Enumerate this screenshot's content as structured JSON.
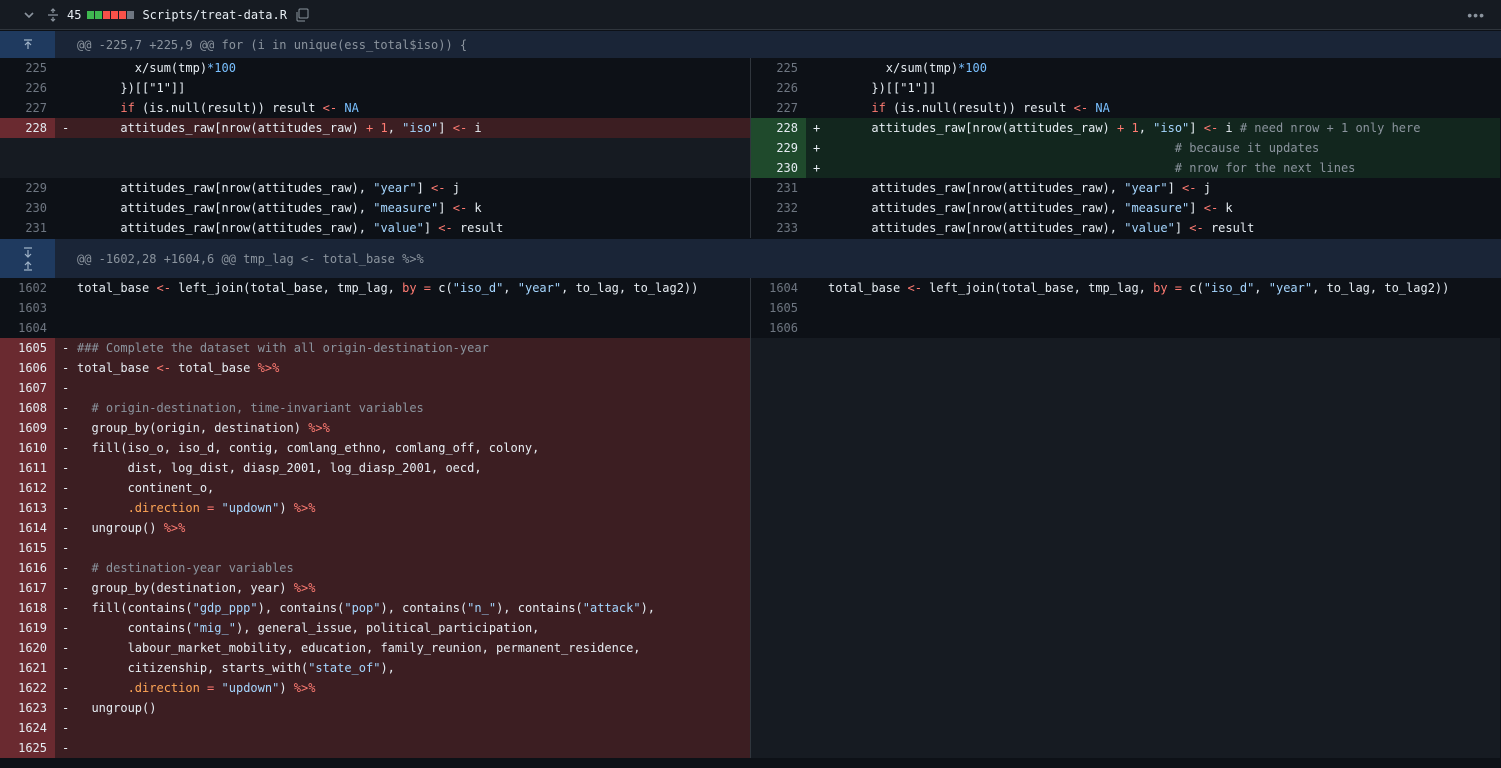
{
  "file_header": {
    "line_count": "45",
    "diffstat_colors": [
      "#3fb950",
      "#3fb950",
      "#f85149",
      "#f85149",
      "#f85149",
      "#6e7681"
    ],
    "file_name": "Scripts/treat-data.R"
  },
  "hunks": [
    {
      "text": "@@ -225,7 +225,9 @@ for (i in unique(ess_total$iso)) {"
    },
    {
      "text": "@@ -1602,28 +1604,6 @@ tmp_lag <- total_base %>%"
    }
  ],
  "line_numbers": {
    "h1_left": [
      "225",
      "226",
      "227",
      "228",
      "229",
      "230",
      "231"
    ],
    "h1_right": [
      "225",
      "226",
      "227",
      "228",
      "229",
      "230",
      "231",
      "232",
      "233"
    ],
    "h2_left": [
      "1602",
      "1603",
      "1604",
      "1605",
      "1606",
      "1607",
      "1608",
      "1609",
      "1610",
      "1611",
      "1612",
      "1613",
      "1614",
      "1615",
      "1616",
      "1617",
      "1618",
      "1619",
      "1620",
      "1621",
      "1622",
      "1623",
      "1624",
      "1625"
    ],
    "h2_right": [
      "1604",
      "1605",
      "1606"
    ]
  },
  "markers": {
    "minus": "-",
    "plus": "+"
  },
  "code": {
    "c_x": "x/sum(tmp)",
    "c_100": "*100",
    "c_close": "})[[\"1\"]]",
    "c_if": "if",
    "c_isnull": " (is.null(result)) result ",
    "c_larrow": "<-",
    "c_na": "NA",
    "c_attr_a": "attitudes_raw[nrow(attitudes_raw) ",
    "c_plus1": "+ 1",
    "c_comma": ", ",
    "c_iso": "\"iso\"",
    "c_bracket_end": "] ",
    "c_i": " i",
    "c_cmt1": "# need nrow + 1 only here",
    "c_cmt2": "# because it updates",
    "c_cmt3": "# nrow for the next lines",
    "c_attr_b": "attitudes_raw[nrow(attitudes_raw), ",
    "c_year": "\"year\"",
    "c_j": " j",
    "c_measure": "\"measure\"",
    "c_k": " k",
    "c_value": "\"value\"",
    "c_result": " result",
    "c_tb": "total_base ",
    "c_lj": " left_join(total_base, tmp_lag, ",
    "c_by": "by",
    "c_eq": " = ",
    "c_cfn": "c(",
    "c_isod": "\"iso_d\"",
    "c_tolag": "to_lag, to_lag2))",
    "c_hdr": "### Complete the dataset with all origin-destination-year",
    "c_pipe": "%>%",
    "c_tb2": " total_base ",
    "c_cmt_od": "# origin-destination, time-invariant variables",
    "c_gb_od": "group_by(origin, destination) ",
    "c_fill1": "fill(iso_o, iso_d, contig, comlang_ethno, comlang_off, colony,",
    "c_fill2": "dist, log_dist, diasp_2001, log_diasp_2001, oecd,",
    "c_fill3": "continent_o,",
    "c_dir": ".direction",
    "c_updown": "\"updown\"",
    "c_paren": ") ",
    "c_ungroup": "ungroup() ",
    "c_cmt_dy": "# destination-year variables",
    "c_gb_dy": "group_by(destination, year) ",
    "c_fill_c": "fill(contains(",
    "c_gdp": "\"gdp_ppp\"",
    "c_contains": "), contains(",
    "c_pop": "\"pop\"",
    "c_n": "\"n_\"",
    "c_attack": "\"attack\"",
    "c_paren_comma": "),",
    "c_contains2": "contains(",
    "c_mig": "\"mig_\"",
    "c_gi": "), general_issue, political_participation,",
    "c_lmm": "labour_market_mobility, education, family_reunion, permanent_residence,",
    "c_cit": "citizenship, starts_with(",
    "c_state": "\"state_of\"",
    "c_ungroup2": "ungroup()"
  }
}
